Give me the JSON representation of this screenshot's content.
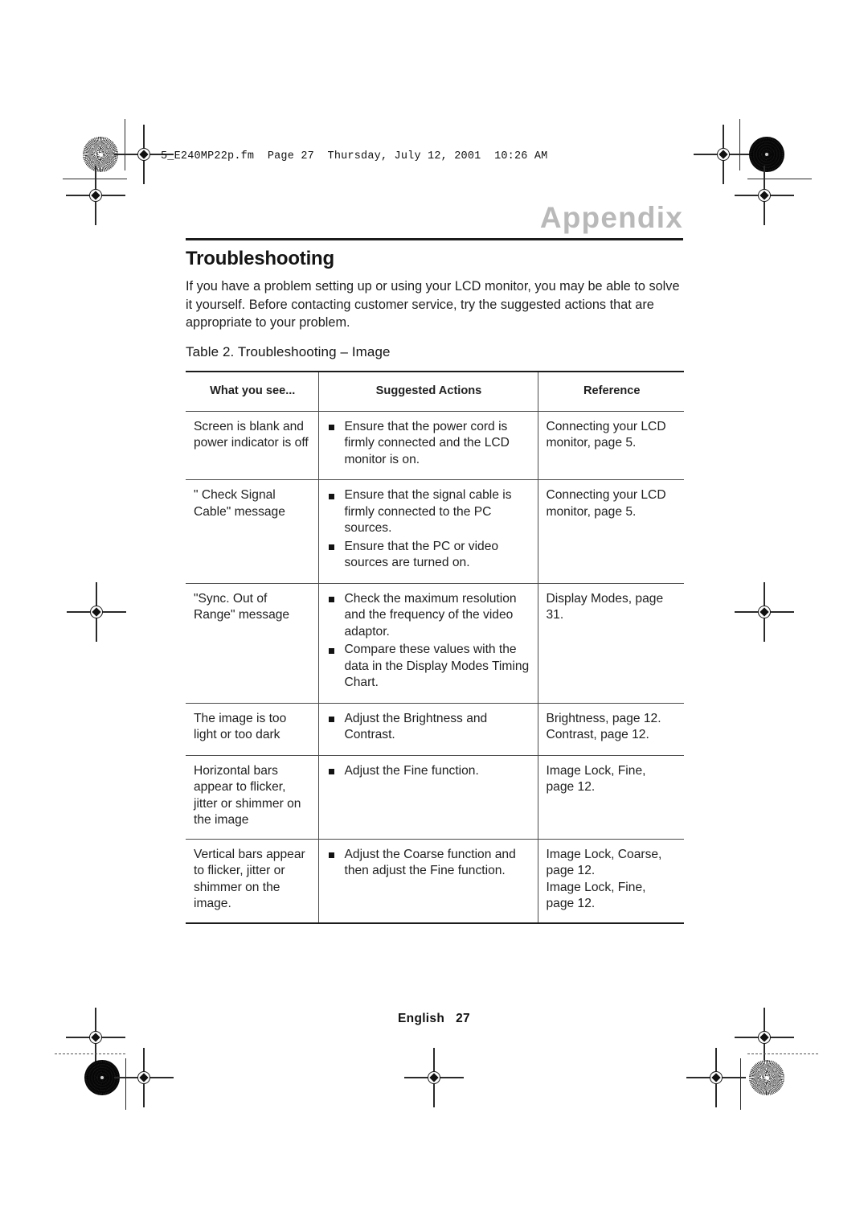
{
  "printmarks": {
    "filestamp": "5_E240MP22p.fm  Page 27  Thursday, July 12, 2001  10:26 AM"
  },
  "header": {
    "appendix_label": "Appendix",
    "section_title": "Troubleshooting"
  },
  "intro": {
    "paragraph": "If you have a problem setting up or using your LCD monitor, you may be able to solve it yourself. Before contacting customer service, try the suggested actions that are appropriate to your problem."
  },
  "table": {
    "caption": "Table 2.  Troubleshooting – Image",
    "columns": [
      "What you see...",
      "Suggested Actions",
      "Reference"
    ],
    "rows": [
      {
        "symptom": "Screen is blank and power indicator is off",
        "actions": [
          "Ensure that the power cord is firmly connected and the LCD monitor is on."
        ],
        "reference": [
          "Connecting your LCD monitor, page 5."
        ]
      },
      {
        "symptom": "\" Check Signal Cable\" message",
        "actions": [
          "Ensure that the signal cable is firmly connected to the PC sources.",
          "Ensure that the PC or video sources are turned on."
        ],
        "reference": [
          "Connecting your LCD monitor, page 5."
        ]
      },
      {
        "symptom": "\"Sync. Out of Range\" message",
        "actions": [
          "Check the maximum resolution and the frequency of the video adaptor.",
          "Compare these values with the data in the Display Modes Timing Chart."
        ],
        "reference": [
          "Display Modes, page 31."
        ]
      },
      {
        "symptom": "The image is too light or too dark",
        "actions": [
          "Adjust the Brightness and Contrast."
        ],
        "reference": [
          "Brightness, page 12.",
          "Contrast, page 12."
        ]
      },
      {
        "symptom": "Horizontal bars appear to flicker, jitter or shimmer on the image",
        "actions": [
          "Adjust the Fine function."
        ],
        "reference": [
          "Image Lock, Fine,",
          "page 12."
        ]
      },
      {
        "symptom": "Vertical bars appear to flicker, jitter or shimmer on the image.",
        "actions": [
          "Adjust the Coarse function and then adjust the Fine function."
        ],
        "reference": [
          "Image Lock, Coarse,",
          "page 12.",
          "Image Lock, Fine,",
          "page 12."
        ]
      }
    ]
  },
  "footer": {
    "language": "English",
    "page_number": "27"
  }
}
